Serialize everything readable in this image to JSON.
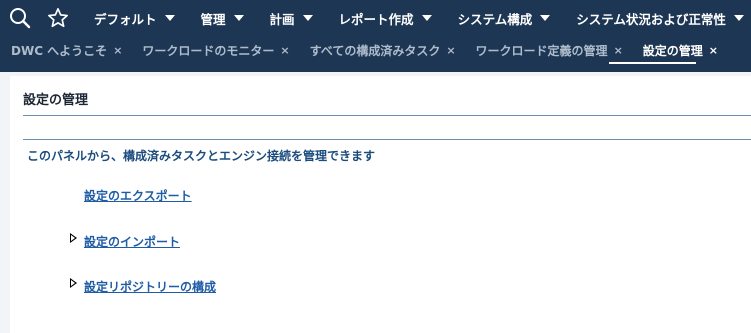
{
  "header": {
    "search_icon": "search-icon",
    "favorites_icon": "star-icon",
    "menu": [
      {
        "label": "デフォルト"
      },
      {
        "label": "管理"
      },
      {
        "label": "計画"
      },
      {
        "label": "レポート作成"
      },
      {
        "label": "システム構成"
      },
      {
        "label": "システム状況および正常性"
      }
    ]
  },
  "tabs": [
    {
      "label": "DWC へようこそ",
      "close": "×"
    },
    {
      "label": "ワークロードのモニター",
      "close": "×"
    },
    {
      "label": "すべての構成済みタスク",
      "close": "×"
    },
    {
      "label": "ワークロード定義の管理",
      "close": "×"
    },
    {
      "label": "設定の管理",
      "close": "×",
      "active": true
    }
  ],
  "page": {
    "title": "設定の管理",
    "description": "このパネルから、構成済みタスクとエンジン接続を管理できます",
    "actions": [
      {
        "label": "設定のエクスポート",
        "expandable": false
      },
      {
        "label": "設定のインポート",
        "expandable": true
      },
      {
        "label": "設定リポジトリーの構成",
        "expandable": true
      }
    ]
  },
  "colors": {
    "header_bg": "#1d3654",
    "link": "#1f5ca6",
    "description": "#1c4c7d",
    "rule": "#6a8fb4"
  }
}
